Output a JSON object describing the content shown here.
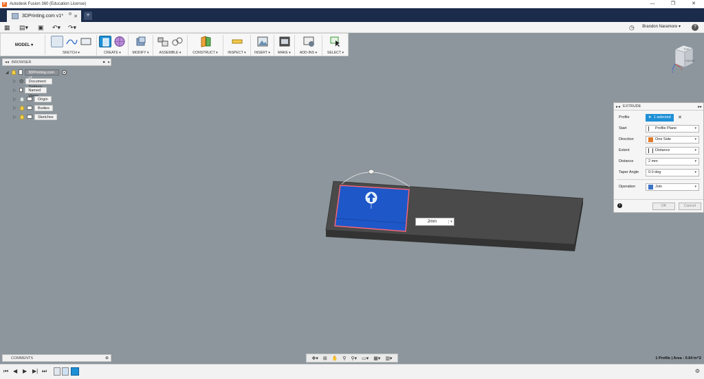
{
  "window": {
    "title": "Autodesk Fusion 360 (Education License)",
    "app_icon": "F",
    "controls": [
      "—",
      "❐",
      "✕"
    ]
  },
  "tabs": [
    {
      "label": "3DPrinting.com v1*"
    }
  ],
  "quick_access": {
    "user": "Brandon Naramore ▾",
    "help": "?"
  },
  "toolbar": {
    "mode": "MODEL ▾",
    "groups": [
      {
        "label": "SKETCH ▾"
      },
      {
        "label": "CREATE ▾"
      },
      {
        "label": "MODIFY ▾"
      },
      {
        "label": "ASSEMBLE ▾"
      },
      {
        "label": "CONSTRUCT ▾"
      },
      {
        "label": "INSPECT ▾"
      },
      {
        "label": "INSERT ▾"
      },
      {
        "label": "MAKE ▾"
      },
      {
        "label": "ADD-INS ▾"
      },
      {
        "label": "SELECT ▾"
      }
    ]
  },
  "browser": {
    "title": "BROWSER",
    "root": "3DPrinting.com v1",
    "items": [
      {
        "label": "Document Settings",
        "icon": "gear-icon"
      },
      {
        "label": "Named Views",
        "icon": "folder-icon"
      },
      {
        "label": "Origin",
        "icon": "folder-icon"
      },
      {
        "label": "Bodies",
        "icon": "folder-icon"
      },
      {
        "label": "Sketches",
        "icon": "folder-icon"
      }
    ]
  },
  "viewcube": {
    "top": "TOP",
    "front": "FRONT",
    "axis_z": "Z",
    "axis_x": "X"
  },
  "canvas": {
    "dimension_value": "2mm"
  },
  "extrude": {
    "title": "EXTRUDE",
    "profile_label": "Profile",
    "profile_value": "1 selected",
    "start_label": "Start",
    "start_value": "Profile Plane",
    "direction_label": "Direction",
    "direction_value": "One Side",
    "extent_label": "Extent",
    "extent_value": "Distance",
    "distance_label": "Distance",
    "distance_value": "2 mm",
    "taper_label": "Taper Angle",
    "taper_value": "0.0 deg",
    "operation_label": "Operation",
    "operation_value": "Join",
    "ok": "OK",
    "cancel": "Cancel"
  },
  "comments": {
    "title": "COMMENTS"
  },
  "status": "1 Profile | Area : 0.64 in^2",
  "colors": {
    "accent": "#1e90d6",
    "tabbar": "#1b2b4a",
    "canvas_bg": "#8c969c",
    "profile_fill": "#1e57c8",
    "profile_outline": "#ff6677"
  }
}
